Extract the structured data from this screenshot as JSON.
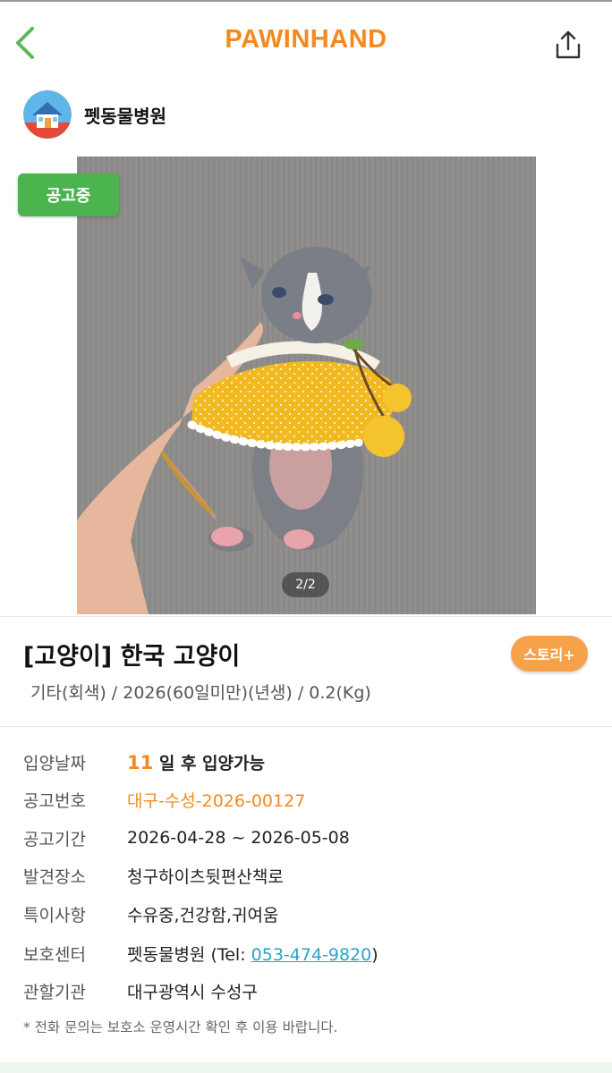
{
  "header": {
    "brand": "PAWINHAND",
    "back_icon": "chevron-left-icon",
    "share_icon": "share-icon"
  },
  "shelter": {
    "name": "펫동물병원",
    "avatar_icon": "house-icon"
  },
  "photo": {
    "status_badge": "공고중",
    "page_indicator": "2/2"
  },
  "pet": {
    "title": "[고양이] 한국 고양이",
    "story_button": "스토리+",
    "summary": "기타(회색) / 2026(60일미만)(년생) / 0.2(Kg)"
  },
  "info": {
    "adoption_label": "입양날짜",
    "adoption_days": "11",
    "adoption_suffix": " 일 후 입양가능",
    "notice_number_label": "공고번호",
    "notice_number": "대구-수성-2026-00127",
    "notice_period_label": "공고기간",
    "notice_period": "2026-04-28 ~ 2026-05-08",
    "found_place_label": "발견장소",
    "found_place": "청구하이츠뒷편산책로",
    "special_notes_label": "특이사항",
    "special_notes": "수유중,건강함,귀여움",
    "shelter_label": "보호센터",
    "shelter_prefix": "펫동물병원 (Tel: ",
    "shelter_tel": "053-474-9820",
    "shelter_suffix": ")",
    "agency_label": "관할기관",
    "agency": "대구광역시 수성구"
  },
  "footnote": "* 전화 문의는 보호소 운영시간 확인 후 이용 바랍니다.",
  "colors": {
    "brand_orange": "#f28a1f",
    "back_green": "#5cb85c",
    "badge_green": "#4cb44e",
    "story_orange": "#f5a24b",
    "link_blue": "#2aa3c8"
  }
}
